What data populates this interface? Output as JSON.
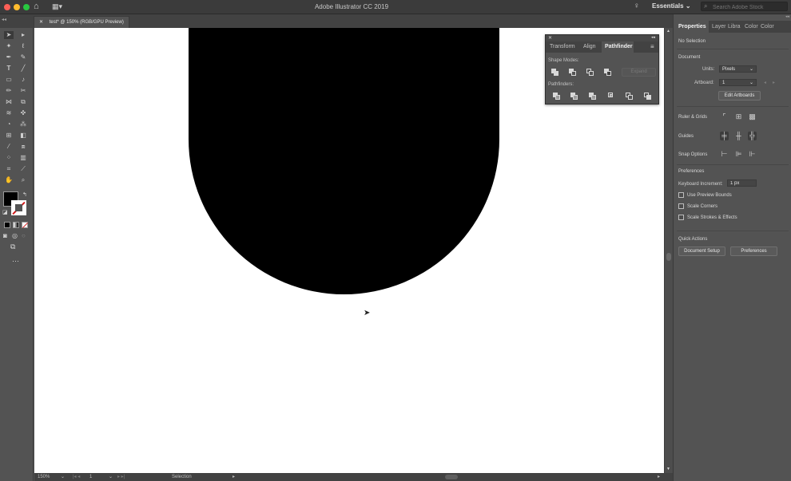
{
  "app": {
    "title": "Adobe Illustrator CC 2019",
    "workspace": "Essentials",
    "search_placeholder": "Search Adobe Stock"
  },
  "document_tab": {
    "label": "test* @ 150% (RGB/GPU Preview)"
  },
  "status": {
    "zoom": "150%",
    "artboard": "1",
    "tool": "Selection"
  },
  "pathfinder_panel": {
    "tabs": [
      "Transform",
      "Align",
      "Pathfinder"
    ],
    "active_tab": "Pathfinder",
    "shape_modes_label": "Shape Modes:",
    "pathfinders_label": "Pathfinders:",
    "expand_label": "Expand"
  },
  "properties_panel": {
    "tabs": [
      "Properties",
      "Layer",
      "Libra",
      "Color",
      "Color"
    ],
    "no_selection": "No Selection",
    "document_label": "Document",
    "units_label": "Units:",
    "units_value": "Pixels",
    "artboard_label": "Artboard:",
    "artboard_value": "1",
    "edit_artboards": "Edit Artboards",
    "rulers_grids": "Ruler & Grids",
    "guides": "Guides",
    "snap_options": "Snap Options",
    "preferences_label": "Preferences",
    "keyboard_increment_label": "Keyboard Increment:",
    "keyboard_increment_value": "1 px",
    "use_preview_bounds": "Use Preview Bounds",
    "scale_corners": "Scale Corners",
    "scale_strokes": "Scale Strokes & Effects",
    "quick_actions": "Quick Actions",
    "document_setup": "Document Setup",
    "preferences_button": "Preferences"
  },
  "colors": {
    "fill": "#000000",
    "canvas": "#ffffff",
    "ui_bg": "#535353"
  }
}
